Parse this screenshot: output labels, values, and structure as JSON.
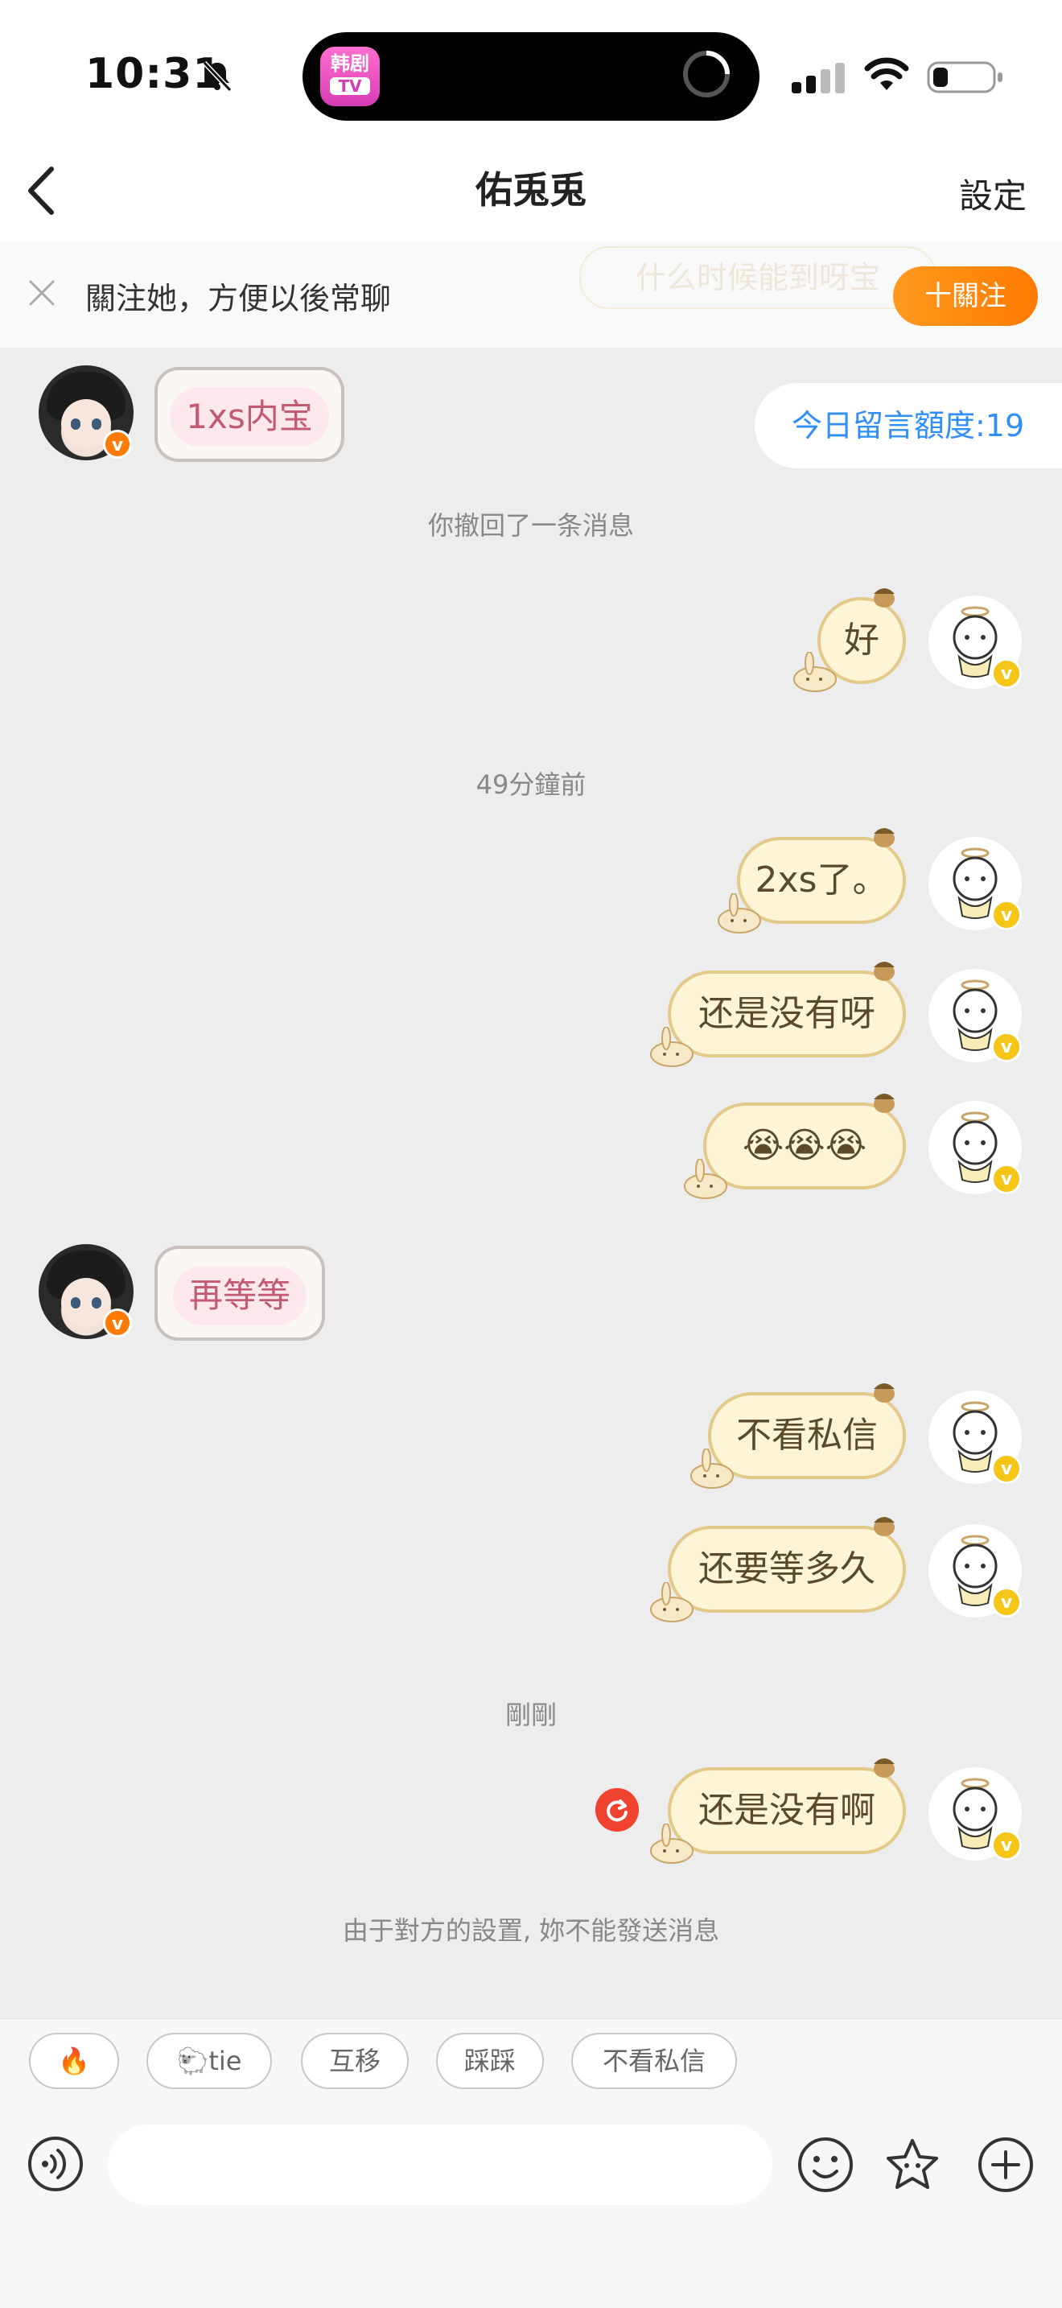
{
  "status": {
    "time": "10:31"
  },
  "app_icon": {
    "line1": "韩剧",
    "line2": "TV"
  },
  "nav": {
    "title": "佑兎兎",
    "settings": "設定"
  },
  "follow_banner": {
    "text": "關注她，方便以後常聊",
    "button": "十關注",
    "ghost_text": "什么时候能到呀宝"
  },
  "quota": "今日留言額度:19",
  "messages": [
    {
      "side": "left",
      "text": "1xs内宝"
    },
    {
      "side": "system",
      "text": "你撤回了一条消息"
    },
    {
      "side": "right",
      "text": "好"
    },
    {
      "side": "system",
      "text": "49分鐘前"
    },
    {
      "side": "right",
      "text": "2xs了。"
    },
    {
      "side": "right",
      "text": "还是没有呀"
    },
    {
      "side": "right",
      "text": "😭😭😭"
    },
    {
      "side": "left",
      "text": "再等等"
    },
    {
      "side": "right",
      "text": "不看私信"
    },
    {
      "side": "right",
      "text": "还要等多久"
    },
    {
      "side": "system",
      "text": "剛剛"
    },
    {
      "side": "right",
      "text": "还是没有啊"
    },
    {
      "side": "system",
      "text": "由于對方的設置, 妳不能發送消息"
    }
  ],
  "quick_replies": [
    "🔥",
    "🐑tie",
    "互移",
    "踩踩",
    "不看私信"
  ],
  "colors": {
    "accent_orange": "#ff7a00",
    "link_blue": "#2f8ef7",
    "bubble_fill": "#fdf5d6",
    "bubble_border": "#e3c98a",
    "retry_red": "#f0432f"
  }
}
